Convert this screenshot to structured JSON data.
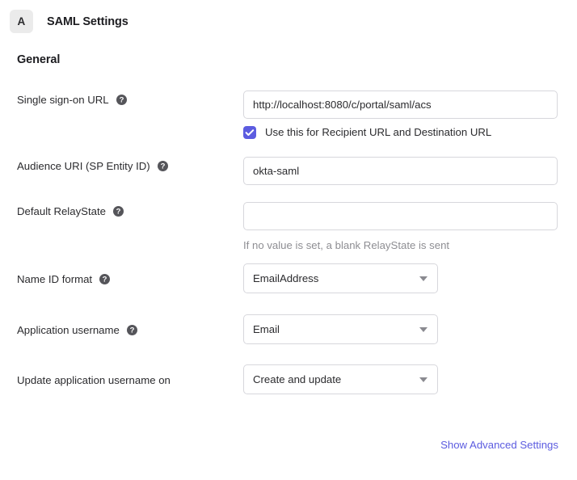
{
  "header": {
    "badge_letter": "A",
    "title": "SAML Settings"
  },
  "section": {
    "heading": "General"
  },
  "fields": {
    "sso_url": {
      "label": "Single sign-on URL",
      "help_icon": "help-circle-icon",
      "value": "http://localhost:8080/c/portal/saml/acs",
      "placeholder": ""
    },
    "recipient_checkbox": {
      "label": "Use this for Recipient URL and Destination URL",
      "checked": true,
      "icon": "checkmark-icon",
      "color": "#5c5ce0"
    },
    "audience_uri": {
      "label": "Audience URI (SP Entity ID)",
      "help_icon": "help-circle-icon",
      "value": "okta-saml",
      "placeholder": ""
    },
    "default_relaystate": {
      "label": "Default RelayState",
      "help_icon": "help-circle-icon",
      "value": "",
      "placeholder": "",
      "helper_text": "If no value is set, a blank RelayState is sent"
    },
    "name_id_format": {
      "label": "Name ID format",
      "help_icon": "help-circle-icon",
      "value": "EmailAddress",
      "caret_icon": "chevron-down-icon"
    },
    "application_username": {
      "label": "Application username",
      "help_icon": "help-circle-icon",
      "value": "Email",
      "caret_icon": "chevron-down-icon"
    },
    "update_username_on": {
      "label": "Update application username on",
      "value": "Create and update",
      "caret_icon": "chevron-down-icon"
    }
  },
  "footer": {
    "advanced_link": "Show Advanced Settings",
    "link_color": "#5c5ce0"
  }
}
